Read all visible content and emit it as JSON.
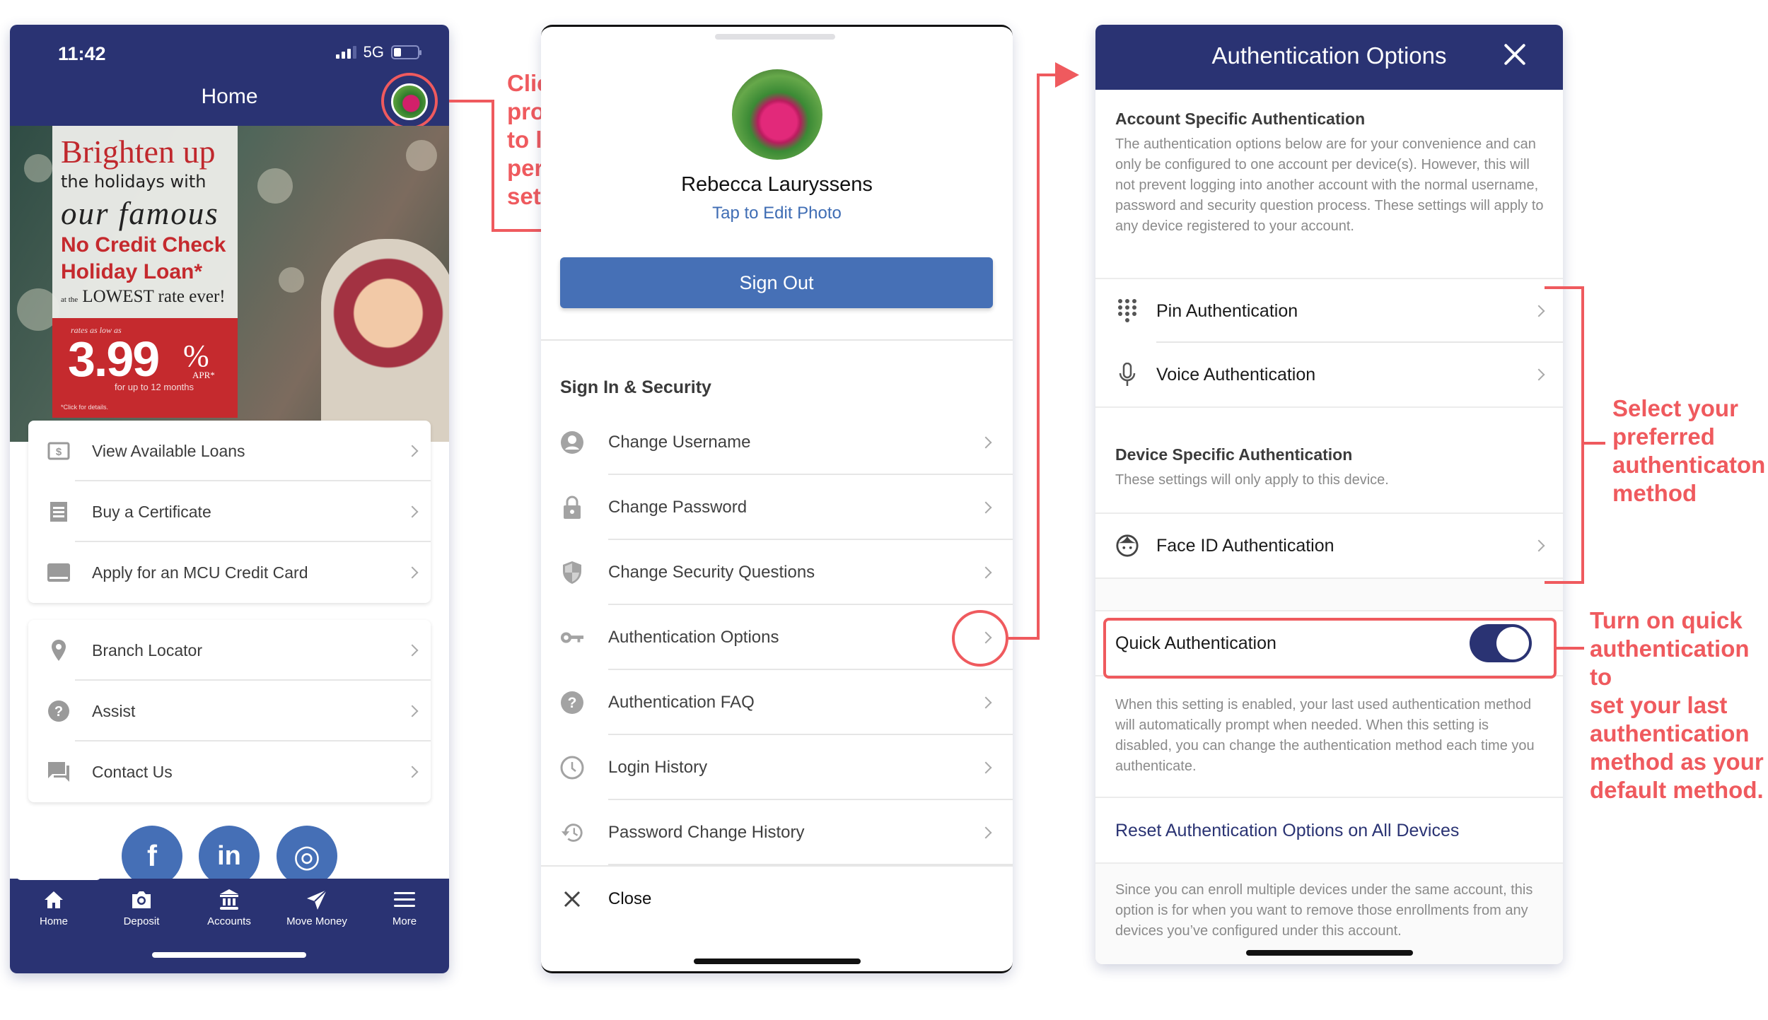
{
  "phone1": {
    "status": {
      "time": "11:42",
      "network": "5G"
    },
    "header": {
      "title": "Home"
    },
    "banner": {
      "line1": "Brighten up",
      "line2": "the holidays with",
      "line3": "our famous",
      "line4": "No Credit Check",
      "line5": "Holiday Loan*",
      "line6_prefix": "at the",
      "line6": "LOWEST rate ever!",
      "rate_caption": "rates as low as",
      "rate": "3.99",
      "rate_unit": "%",
      "rate_type": "APR*",
      "term": "for up to 12 months",
      "footnote": "*Click for details."
    },
    "menu_group_1": [
      {
        "icon": "dollar-bill-icon",
        "label": "View Available Loans"
      },
      {
        "icon": "receipt-icon",
        "label": "Buy a Certificate"
      },
      {
        "icon": "credit-card-icon",
        "label": "Apply for an MCU Credit Card"
      }
    ],
    "menu_group_2": [
      {
        "icon": "location-pin-icon",
        "label": "Branch Locator"
      },
      {
        "icon": "help-circle-icon",
        "label": "Assist"
      },
      {
        "icon": "chat-icon",
        "label": "Contact Us"
      }
    ],
    "social": [
      {
        "icon": "facebook-icon",
        "glyph": "f"
      },
      {
        "icon": "linkedin-icon",
        "glyph": "in"
      },
      {
        "icon": "instagram-icon",
        "glyph": "◎"
      }
    ],
    "bottom_nav": [
      {
        "icon": "home-icon",
        "label": "Home"
      },
      {
        "icon": "camera-icon",
        "label": "Deposit"
      },
      {
        "icon": "bank-icon",
        "label": "Accounts"
      },
      {
        "icon": "send-icon",
        "label": "Move Money"
      },
      {
        "icon": "menu-icon",
        "label": "More"
      }
    ]
  },
  "annotations": {
    "profile": [
      "Click your",
      "profile picture",
      "to look at your",
      "personal",
      "settings"
    ],
    "preferred": [
      "Select your",
      "preferred",
      "authenticaton",
      "method"
    ],
    "quick": [
      "Turn on quick",
      "authentication to",
      "set your last",
      "authentication",
      "method as your",
      "default method."
    ]
  },
  "phone2": {
    "user_name": "Rebecca Lauryssens",
    "edit_photo": "Tap to Edit Photo",
    "sign_out": "Sign Out",
    "section_title": "Sign In & Security",
    "items": [
      {
        "icon": "user-circle-icon",
        "label": "Change Username"
      },
      {
        "icon": "lock-icon",
        "label": "Change Password"
      },
      {
        "icon": "shield-icon",
        "label": "Change Security Questions"
      },
      {
        "icon": "key-icon",
        "label": "Authentication Options"
      },
      {
        "icon": "help-circle-icon",
        "label": "Authentication FAQ"
      },
      {
        "icon": "clock-icon",
        "label": "Login History"
      },
      {
        "icon": "history-icon",
        "label": "Password Change History"
      }
    ],
    "close": "Close"
  },
  "phone3": {
    "title": "Authentication Options",
    "account_heading": "Account Specific Authentication",
    "account_desc": "The authentication options below are for your convenience and can only be configured to one account per device(s). However, this will not prevent logging into another account with the normal username, password and security question process. These settings will apply to any device registered to your account.",
    "account_items": [
      {
        "icon": "dialpad-icon",
        "label": "Pin Authentication"
      },
      {
        "icon": "microphone-icon",
        "label": "Voice Authentication"
      }
    ],
    "device_heading": "Device Specific Authentication",
    "device_desc": "These settings will only apply to this device.",
    "device_items": [
      {
        "icon": "face-icon",
        "label": "Face ID Authentication"
      }
    ],
    "quick_auth": {
      "label": "Quick Authentication",
      "enabled": true
    },
    "quick_desc": "When this setting is enabled, your last used authentication method will automatically prompt when needed. When this setting is disabled, you can change the authentication method each time you authenticate.",
    "reset_link": "Reset Authentication Options on All Devices",
    "reset_desc": "Since you can enroll multiple devices under the same account, this option is for when you want to remove those enrollments from any devices you’ve configured under this account."
  },
  "colors": {
    "navy": "#2a3373",
    "button_blue": "#4670b6",
    "annotation_red": "#ef5a5e",
    "banner_red": "#c52a2e"
  }
}
